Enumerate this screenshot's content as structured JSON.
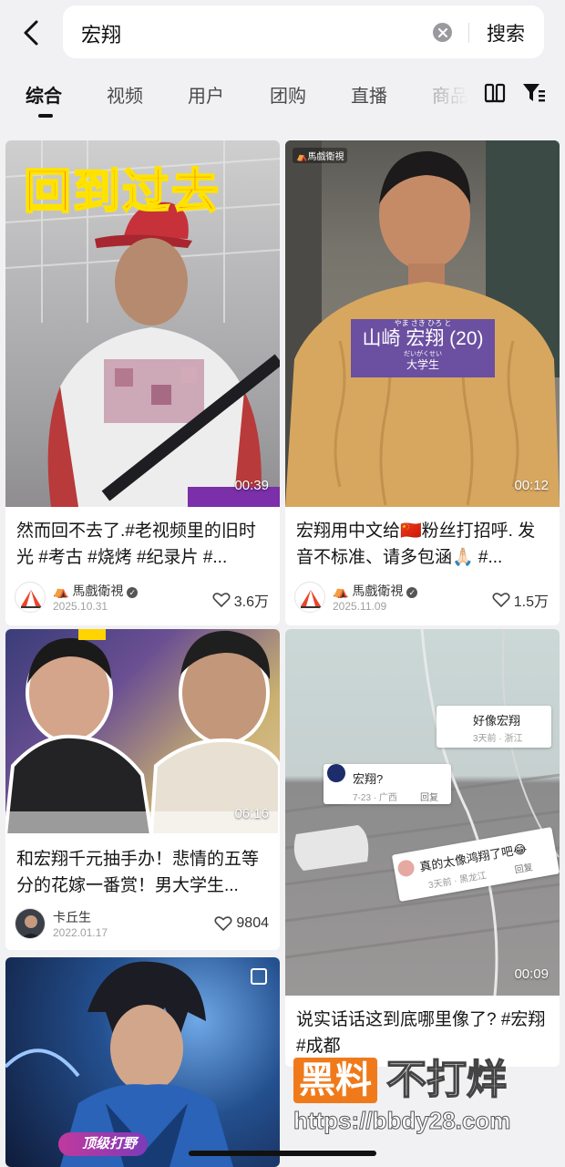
{
  "search": {
    "query": "宏翔",
    "submit_label": "搜索"
  },
  "tabs": [
    {
      "label": "综合"
    },
    {
      "label": "视频"
    },
    {
      "label": "用户"
    },
    {
      "label": "团购"
    },
    {
      "label": "直播"
    },
    {
      "label": "商品"
    }
  ],
  "cards": [
    {
      "overlay_text": "回到过去",
      "duration": "00:39",
      "title": "然而回不去了.#老视频里的旧时光 #考古 #烧烤 #纪录片 #...",
      "author": "馬戲衛視",
      "date": "2025.10.31",
      "likes": "3.6万"
    },
    {
      "source_badge": "馬戲衛視",
      "caption_ruby": "やま さき  ひろ と",
      "caption_name": "山崎 宏翔 (20)",
      "caption_ruby2": "だいがくせい",
      "caption_sub": "大学生",
      "duration": "00:12",
      "title": "宏翔用中文给🇨🇳粉丝打招呼. 发音不标准、请多包涵🙏🏻 #...",
      "author": "馬戲衛視",
      "date": "2025.11.09",
      "likes": "1.5万"
    },
    {
      "duration": "06:16",
      "title": "和宏翔千元抽手办！悲情的五等分的花嫁一番赏！男大学生...",
      "author": "卡丘生",
      "date": "2022.01.17",
      "likes": "9804"
    },
    {
      "comments": [
        {
          "text": "好像宏翔",
          "meta": "3天前 · 浙江"
        },
        {
          "text": "宏翔?",
          "meta": "7-23 · 广西",
          "reply": "回复"
        },
        {
          "text": "真的太像鸿翔了吧😂",
          "meta": "3天前 · 黑龙江",
          "reply": "回复"
        }
      ],
      "duration": "00:09",
      "title": "说实话话这到底哪里像了? #宏翔 #成都"
    },
    {
      "badge": "顶级打野"
    }
  ],
  "watermark": {
    "brand": "黑料",
    "slogan": "不打烊",
    "url": "https://bbdy28.com"
  },
  "colors": {
    "accent": "#e8452c",
    "watermark_orange": "#f07a1a"
  }
}
